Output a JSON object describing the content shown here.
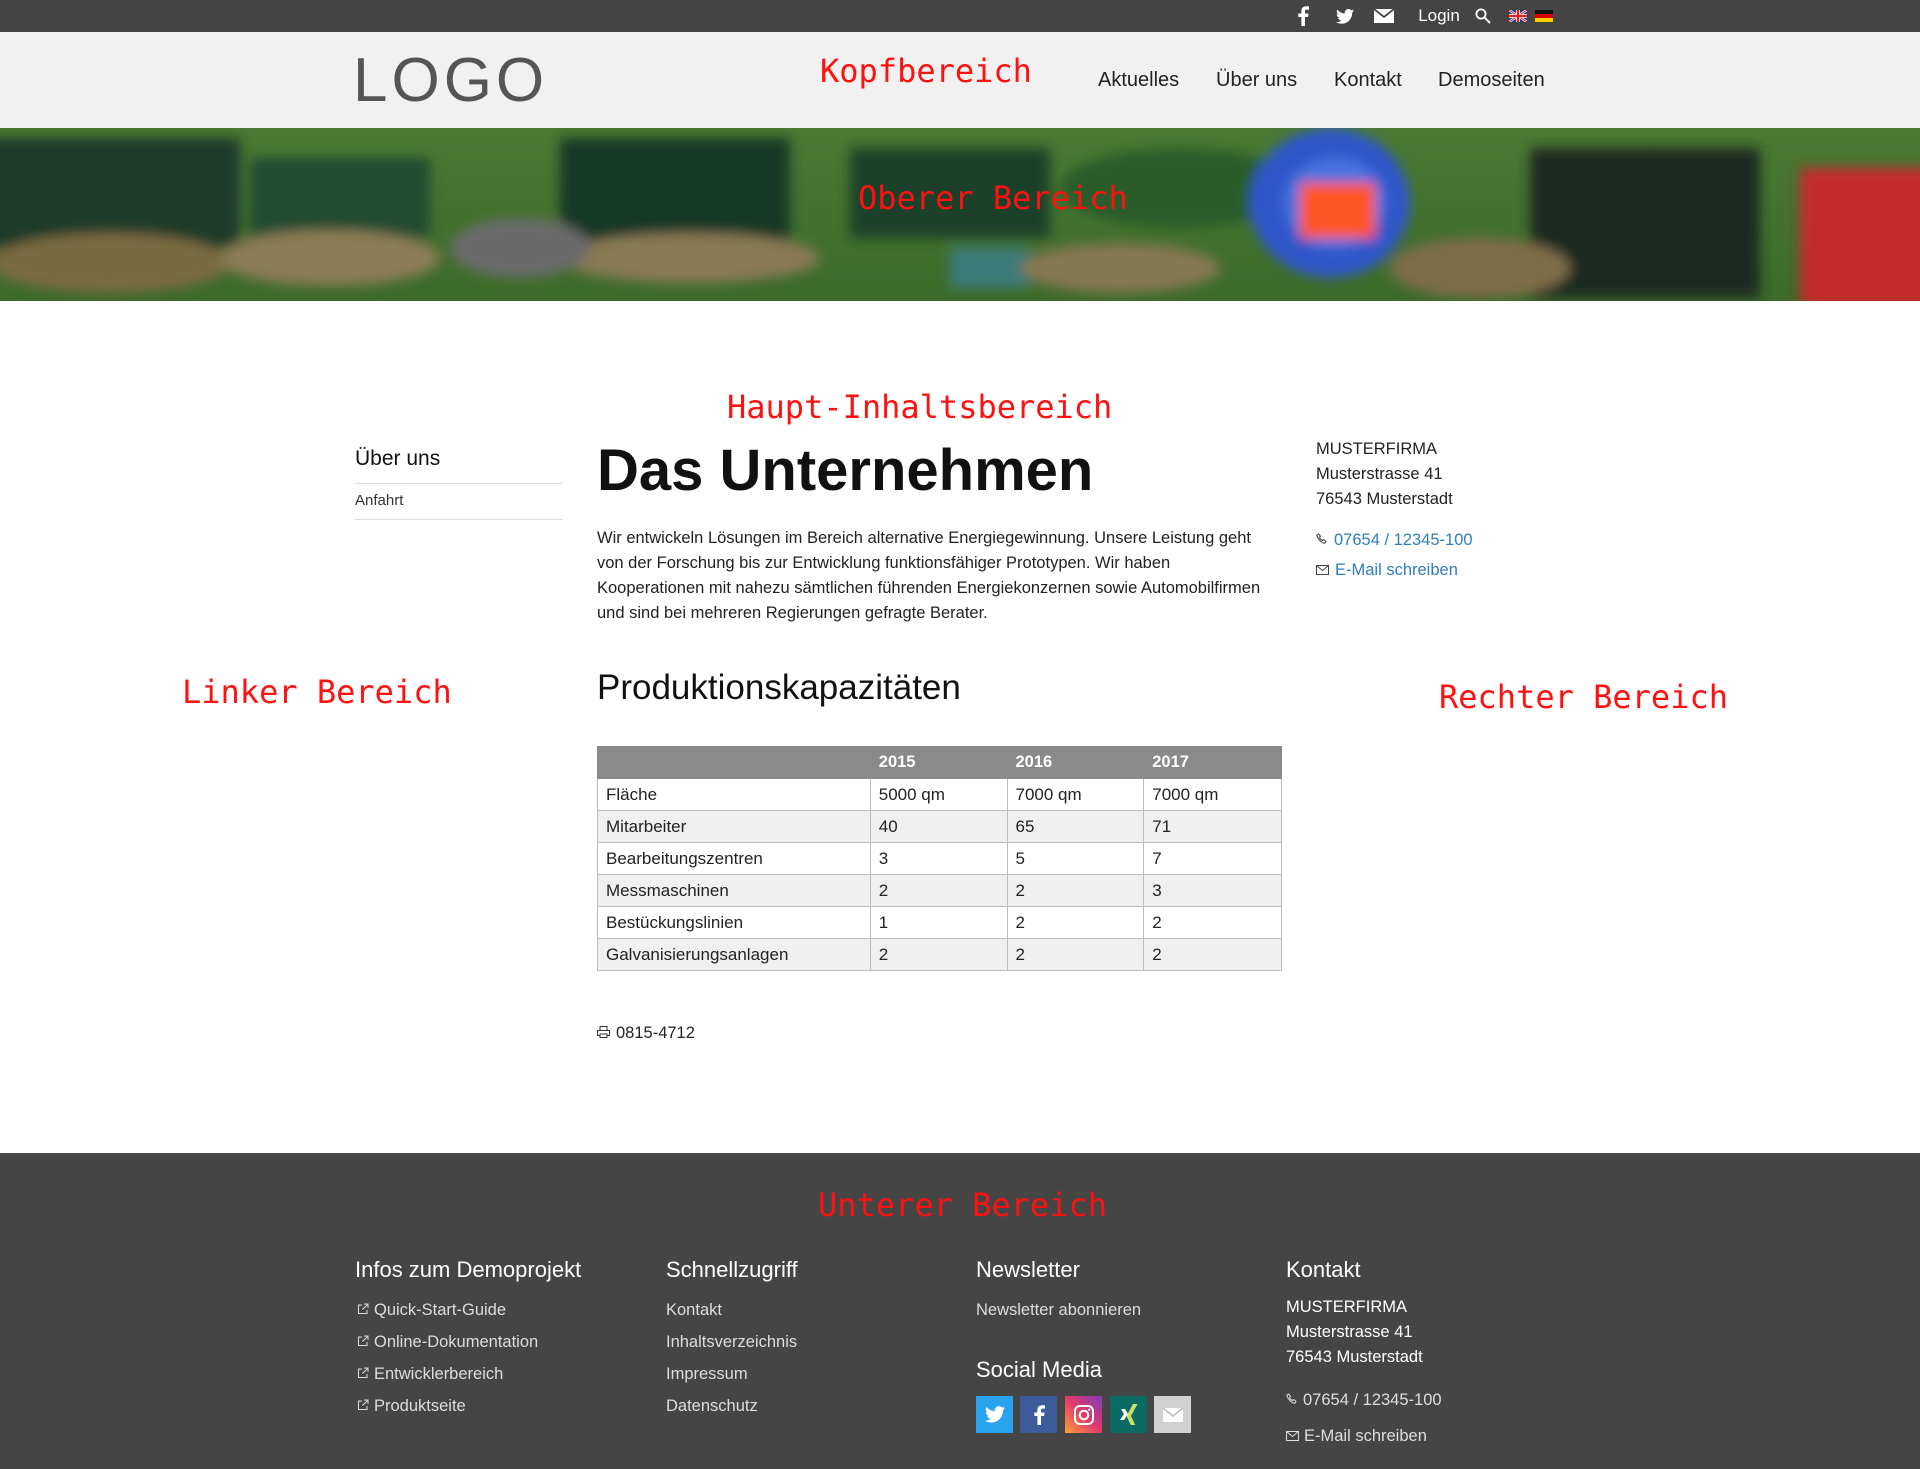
{
  "topbar": {
    "login_label": "Login",
    "icons": [
      "facebook-icon",
      "twitter-icon",
      "mail-icon",
      "search-icon",
      "flag-uk-icon",
      "flag-de-icon"
    ]
  },
  "header": {
    "logo_text": "LOGO",
    "nav": [
      "Aktuelles",
      "Über uns",
      "Kontakt",
      "Demoseiten"
    ]
  },
  "region_labels": {
    "kopf": "Kopfbereich",
    "oben": "Oberer Bereich",
    "haupt": "Haupt-Inhaltsbereich",
    "links": "Linker Bereich",
    "rechts": "Rechter Bereich",
    "unten": "Unterer Bereich"
  },
  "sidebar": {
    "title": "Über uns",
    "items": [
      "Anfahrt"
    ]
  },
  "main": {
    "title": "Das Unternehmen",
    "intro": "Wir entwickeln Lösungen im Bereich alternative Energiegewinnung. Unsere Leistung geht von der Forschung bis zur Entwicklung funktionsfähiger Prototypen. Wir haben Kooperationen mit nahezu sämtlichen führenden Energiekonzernen sowie Automobilfirmen und sind bei mehreren Regierungen gefragte Berater.",
    "subtitle": "Produktionskapazitäten",
    "table": {
      "headers": [
        "",
        "2015",
        "2016",
        "2017"
      ],
      "rows": [
        [
          "Fläche",
          "5000 qm",
          "7000 qm",
          "7000 qm"
        ],
        [
          "Mitarbeiter",
          "40",
          "65",
          "71"
        ],
        [
          "Bearbeitungszentren",
          "3",
          "5",
          "7"
        ],
        [
          "Messmaschinen",
          "2",
          "2",
          "3"
        ],
        [
          "Bestückungslinien",
          "1",
          "2",
          "2"
        ],
        [
          "Galvanisierungsanlagen",
          "2",
          "2",
          "2"
        ]
      ]
    },
    "fax": "0815-4712"
  },
  "right": {
    "company": "MUSTERFIRMA",
    "street": "Musterstrasse 41",
    "city": "76543 Musterstadt",
    "phone": "07654 / 12345-100",
    "email_label": "E-Mail schreiben"
  },
  "footer": {
    "col1": {
      "heading": "Infos zum Demoprojekt",
      "links": [
        "Quick-Start-Guide",
        "Online-Dokumentation",
        "Entwicklerbereich",
        "Produktseite"
      ]
    },
    "col2": {
      "heading": "Schnellzugriff",
      "links": [
        "Kontakt",
        "Inhaltsverzeichnis",
        "Impressum",
        "Datenschutz"
      ]
    },
    "col3": {
      "heading": "Newsletter",
      "link": "Newsletter abonnieren",
      "social_heading": "Social Media",
      "social_icons": [
        "twitter-icon",
        "facebook-icon",
        "instagram-icon",
        "xing-icon",
        "email-icon"
      ]
    },
    "col4": {
      "heading": "Kontakt",
      "company": "MUSTERFIRMA",
      "street": "Musterstrasse 41",
      "city": "76543 Musterstadt",
      "phone": "07654 / 12345-100",
      "email_label": "E-Mail schreiben"
    }
  },
  "colors": {
    "topbar": "#444444",
    "header": "#f1f1f1",
    "footer": "#454545",
    "table_header": "#8a8a8a",
    "link": "#2f7dbf",
    "region_label": "#ff1111"
  }
}
